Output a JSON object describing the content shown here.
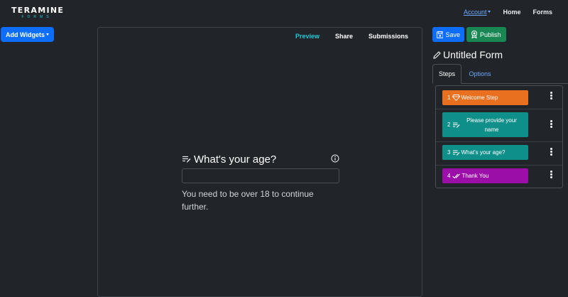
{
  "brand": {
    "name": "TERAMINE",
    "sub": "FORMS"
  },
  "nav": {
    "account": "Account",
    "home": "Home",
    "forms": "Forms"
  },
  "toolbar": {
    "add_widgets": "Add Widgets"
  },
  "canvas": {
    "tabs": {
      "preview": "Preview",
      "share": "Share",
      "submissions": "Submissions"
    },
    "question": {
      "title": "What's your age?",
      "value": "",
      "help": "You need to be over 18 to continue further."
    }
  },
  "sidebar": {
    "save": "Save",
    "publish": "Publish",
    "form_title": "Untitled Form",
    "tabs": {
      "steps": "Steps",
      "options": "Options"
    },
    "steps": [
      {
        "num": "1",
        "label": "Welcome Step",
        "color": "#e8701f",
        "icon": "diamond-icon"
      },
      {
        "num": "2",
        "label": "Please provide your name",
        "color": "#0f8f8a",
        "icon": "text-edit-icon"
      },
      {
        "num": "3",
        "label": "What's your age?",
        "color": "#0f8f8a",
        "icon": "text-edit-icon"
      },
      {
        "num": "4",
        "label": "Thank You",
        "color": "#9b0fa8",
        "icon": "double-check-icon"
      }
    ]
  },
  "colors": {
    "background": "#212529",
    "primary": "#0d6efd",
    "success": "#198754",
    "accent": "#20c9d6"
  }
}
